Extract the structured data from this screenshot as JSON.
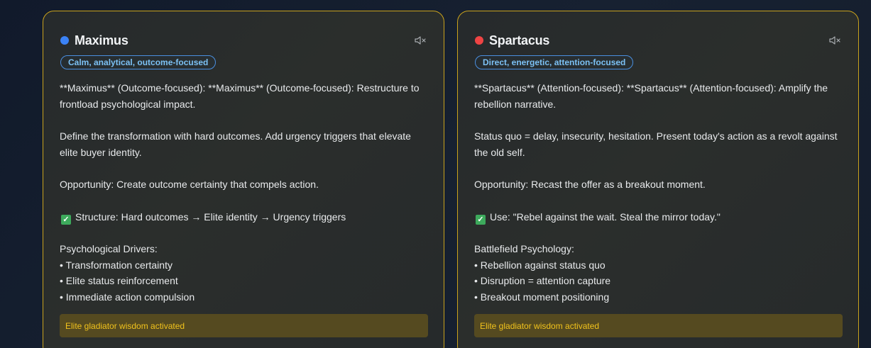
{
  "colors": {
    "card_border": "#c9a21c",
    "maximus_dot": "#3b82f6",
    "spartacus_dot": "#ef4444",
    "badge_border": "#4a8fe0",
    "badge_text": "#7cc1f4",
    "status_bg": "#554a20",
    "status_text": "#f1c21c"
  },
  "cards": [
    {
      "name": "Maximus",
      "mute_icon": "speaker-muted-icon",
      "badge": "Calm, analytical, outcome-focused",
      "paragraphs": {
        "intro": "**Maximus** (Outcome-focused): **Maximus** (Outcome-focused): Restructure to frontload psychological impact.",
        "define": "Define the transformation with hard outcomes. Add urgency triggers that elevate elite buyer identity.",
        "opportunity": "Opportunity: Create outcome certainty that compels action.",
        "check_line": "Structure: Hard outcomes → Elite identity → Urgency triggers",
        "list_title": "Psychological Drivers:",
        "bullets": [
          "• Transformation certainty",
          "• Elite status reinforcement",
          "• Immediate action compulsion"
        ]
      },
      "status": "Elite gladiator wisdom activated"
    },
    {
      "name": "Spartacus",
      "mute_icon": "speaker-muted-icon",
      "badge": "Direct, energetic, attention-focused",
      "paragraphs": {
        "intro": "**Spartacus** (Attention-focused): **Spartacus** (Attention-focused): Amplify the rebellion narrative.",
        "define": "Status quo = delay, insecurity, hesitation. Present today's action as a revolt against the old self.",
        "opportunity": "Opportunity: Recast the offer as a breakout moment.",
        "check_line": "Use: \"Rebel against the wait. Steal the mirror today.\"",
        "list_title": "Battlefield Psychology:",
        "bullets": [
          "• Rebellion against status quo",
          "• Disruption = attention capture",
          "• Breakout moment positioning"
        ]
      },
      "status": "Elite gladiator wisdom activated"
    }
  ]
}
